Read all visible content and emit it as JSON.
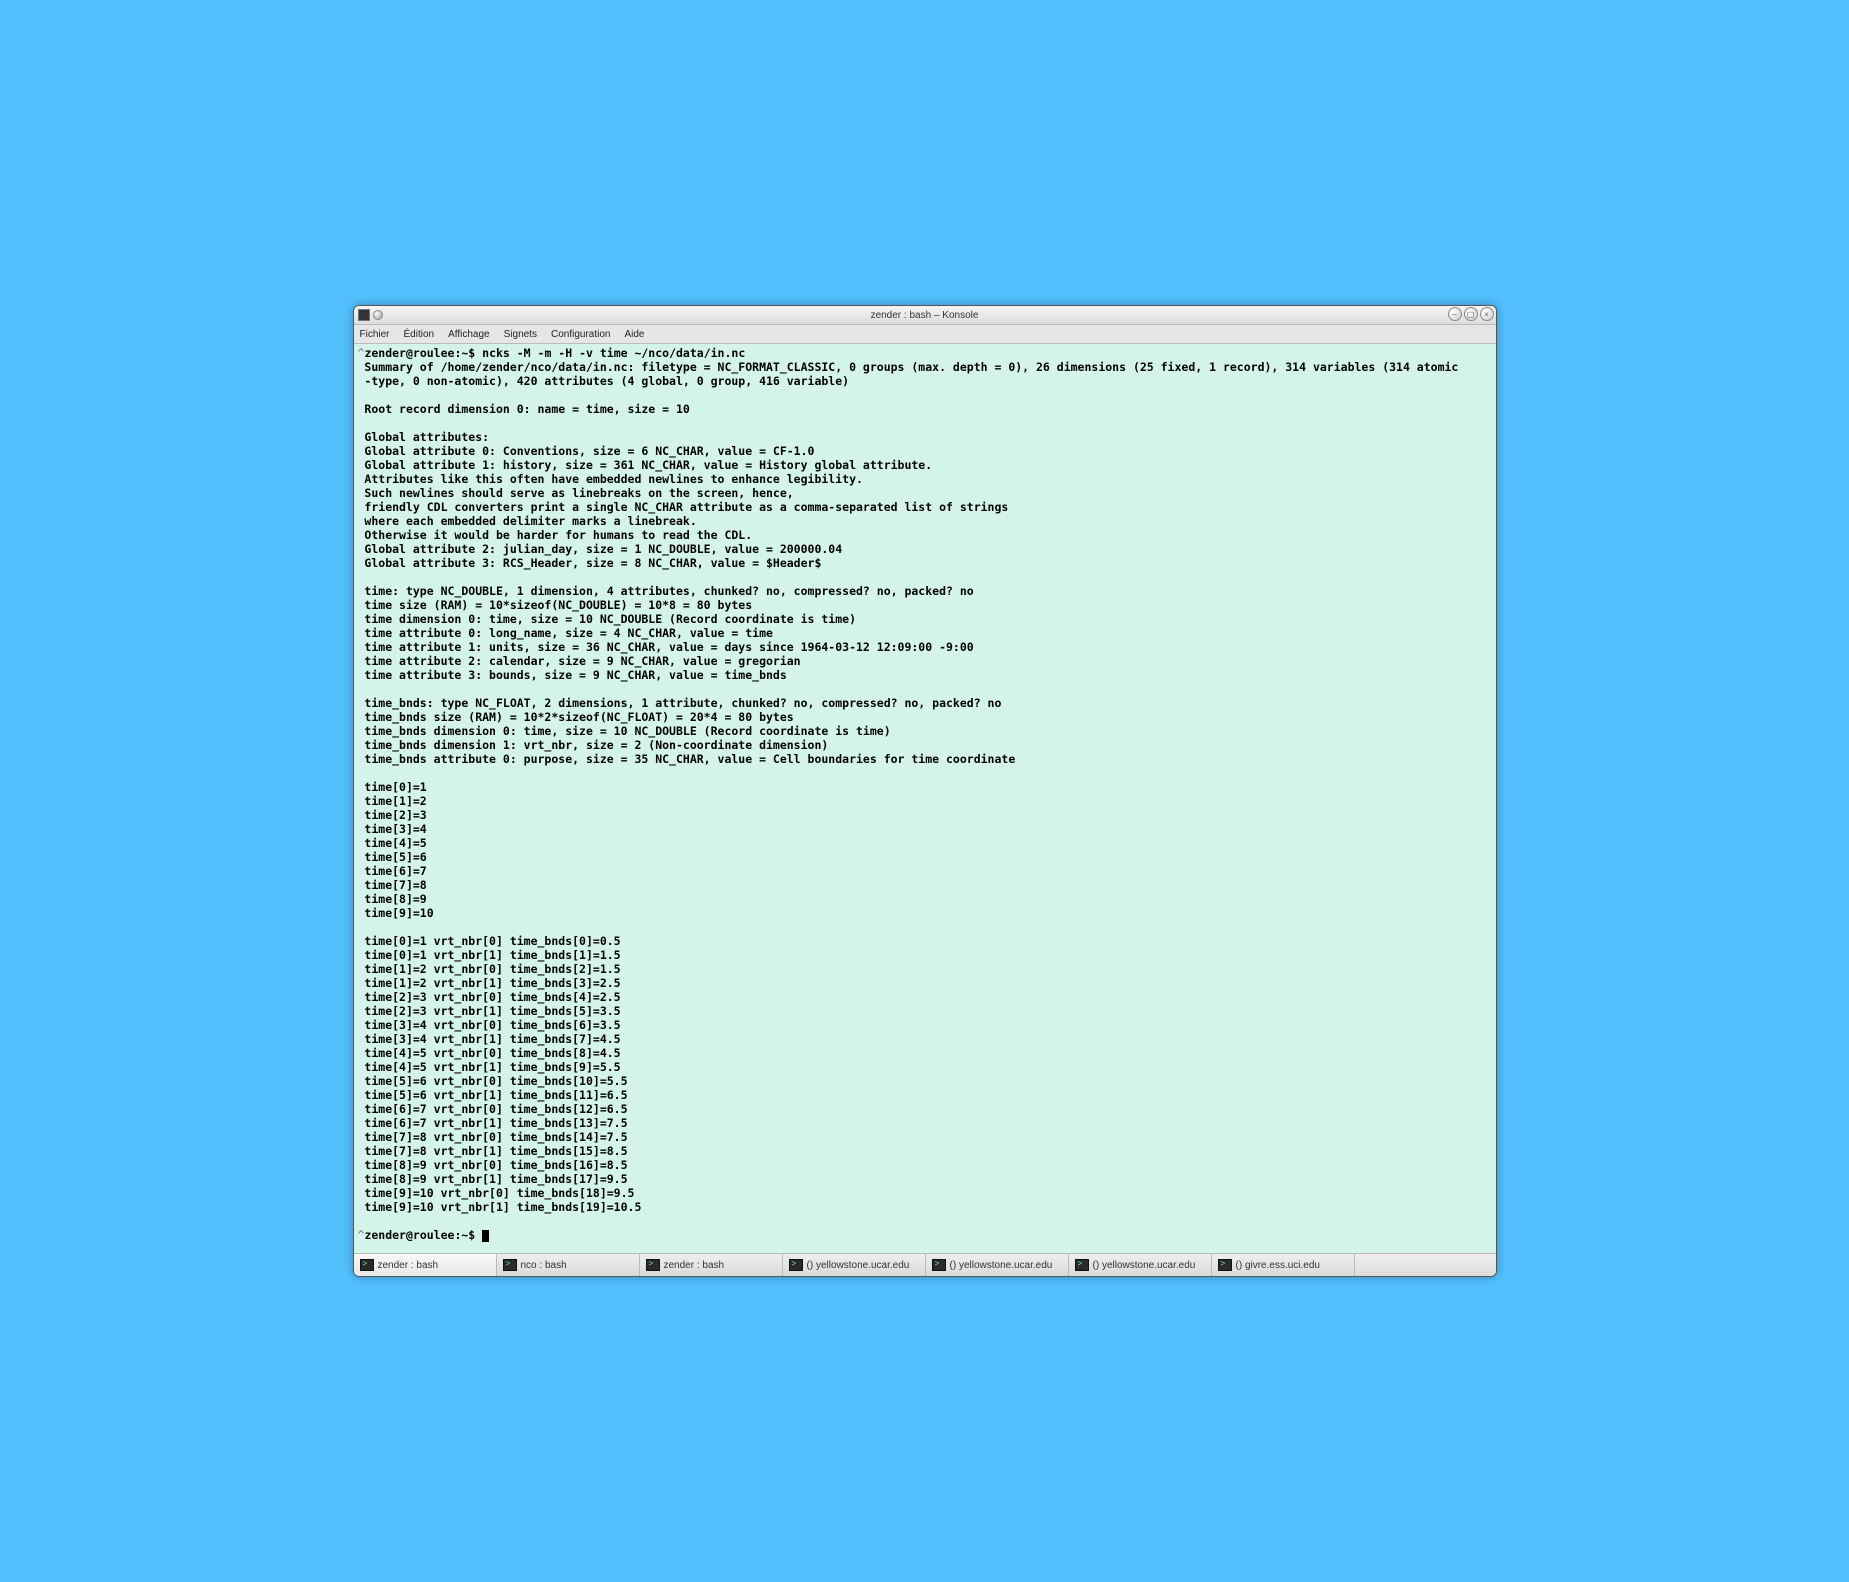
{
  "window": {
    "title": "zender : bash – Konsole"
  },
  "menu": {
    "items": [
      "Fichier",
      "Édition",
      "Affichage",
      "Signets",
      "Configuration",
      "Aide"
    ]
  },
  "terminal": {
    "prompt1_caret": "^",
    "prompt1": "zender@roulee:~$ ",
    "command": "ncks -M -m -H -v time ~/nco/data/in.nc",
    "lines": [
      "Summary of /home/zender/nco/data/in.nc: filetype = NC_FORMAT_CLASSIC, 0 groups (max. depth = 0), 26 dimensions (25 fixed, 1 record), 314 variables (314 atomic",
      "-type, 0 non-atomic), 420 attributes (4 global, 0 group, 416 variable)",
      "",
      "Root record dimension 0: name = time, size = 10",
      "",
      "Global attributes:",
      "Global attribute 0: Conventions, size = 6 NC_CHAR, value = CF-1.0",
      "Global attribute 1: history, size = 361 NC_CHAR, value = History global attribute.",
      "Attributes like this often have embedded newlines to enhance legibility.",
      "Such newlines should serve as linebreaks on the screen, hence,",
      "friendly CDL converters print a single NC_CHAR attribute as a comma-separated list of strings",
      "where each embedded delimiter marks a linebreak.",
      "Otherwise it would be harder for humans to read the CDL.",
      "Global attribute 2: julian_day, size = 1 NC_DOUBLE, value = 200000.04",
      "Global attribute 3: RCS_Header, size = 8 NC_CHAR, value = $Header$",
      "",
      "time: type NC_DOUBLE, 1 dimension, 4 attributes, chunked? no, compressed? no, packed? no",
      "time size (RAM) = 10*sizeof(NC_DOUBLE) = 10*8 = 80 bytes",
      "time dimension 0: time, size = 10 NC_DOUBLE (Record coordinate is time)",
      "time attribute 0: long_name, size = 4 NC_CHAR, value = time",
      "time attribute 1: units, size = 36 NC_CHAR, value = days since 1964-03-12 12:09:00 -9:00",
      "time attribute 2: calendar, size = 9 NC_CHAR, value = gregorian",
      "time attribute 3: bounds, size = 9 NC_CHAR, value = time_bnds",
      "",
      "time_bnds: type NC_FLOAT, 2 dimensions, 1 attribute, chunked? no, compressed? no, packed? no",
      "time_bnds size (RAM) = 10*2*sizeof(NC_FLOAT) = 20*4 = 80 bytes",
      "time_bnds dimension 0: time, size = 10 NC_DOUBLE (Record coordinate is time)",
      "time_bnds dimension 1: vrt_nbr, size = 2 (Non-coordinate dimension)",
      "time_bnds attribute 0: purpose, size = 35 NC_CHAR, value = Cell boundaries for time coordinate",
      "",
      "time[0]=1",
      "time[1]=2",
      "time[2]=3",
      "time[3]=4",
      "time[4]=5",
      "time[5]=6",
      "time[6]=7",
      "time[7]=8",
      "time[8]=9",
      "time[9]=10",
      "",
      "time[0]=1 vrt_nbr[0] time_bnds[0]=0.5",
      "time[0]=1 vrt_nbr[1] time_bnds[1]=1.5",
      "time[1]=2 vrt_nbr[0] time_bnds[2]=1.5",
      "time[1]=2 vrt_nbr[1] time_bnds[3]=2.5",
      "time[2]=3 vrt_nbr[0] time_bnds[4]=2.5",
      "time[2]=3 vrt_nbr[1] time_bnds[5]=3.5",
      "time[3]=4 vrt_nbr[0] time_bnds[6]=3.5",
      "time[3]=4 vrt_nbr[1] time_bnds[7]=4.5",
      "time[4]=5 vrt_nbr[0] time_bnds[8]=4.5",
      "time[4]=5 vrt_nbr[1] time_bnds[9]=5.5",
      "time[5]=6 vrt_nbr[0] time_bnds[10]=5.5",
      "time[5]=6 vrt_nbr[1] time_bnds[11]=6.5",
      "time[6]=7 vrt_nbr[0] time_bnds[12]=6.5",
      "time[6]=7 vrt_nbr[1] time_bnds[13]=7.5",
      "time[7]=8 vrt_nbr[0] time_bnds[14]=7.5",
      "time[7]=8 vrt_nbr[1] time_bnds[15]=8.5",
      "time[8]=9 vrt_nbr[0] time_bnds[16]=8.5",
      "time[8]=9 vrt_nbr[1] time_bnds[17]=9.5",
      "time[9]=10 vrt_nbr[0] time_bnds[18]=9.5",
      "time[9]=10 vrt_nbr[1] time_bnds[19]=10.5",
      ""
    ],
    "prompt2_caret": "^",
    "prompt2": "zender@roulee:~$ "
  },
  "taskbar": {
    "tabs": [
      "zender : bash",
      "nco : bash",
      "zender : bash",
      "() yellowstone.ucar.edu",
      "() yellowstone.ucar.edu",
      "() yellowstone.ucar.edu",
      "() givre.ess.uci.edu"
    ]
  }
}
